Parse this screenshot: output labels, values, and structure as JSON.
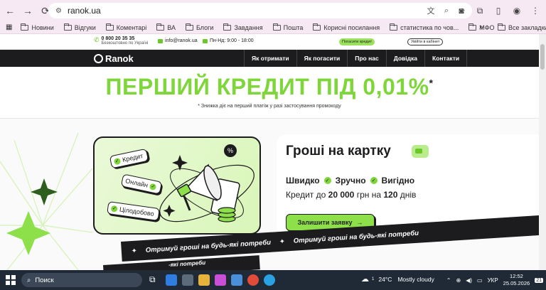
{
  "browser": {
    "url": "ranok.ua",
    "bookmarks": [
      "Новини",
      "Відгуки",
      "Коментарі",
      "ВА",
      "Блоги",
      "Завдання",
      "Пошта",
      "Корисні посилання",
      "статистика по чов...",
      "МФО"
    ],
    "all_bookmarks": "Все закладки"
  },
  "topbar": {
    "phone": "0 800 20 35 35",
    "phone_note": "Безкоштовно по Україні",
    "email": "info@ranok.ua",
    "hours": "Пн-Нд: 9:00 - 18:00",
    "pay_label": "Погасити кредит",
    "login_label": "Увійти в кабінет"
  },
  "nav": {
    "logo": "Ranok",
    "items": [
      "Як отримати",
      "Як погасити",
      "Про нас",
      "Довідка",
      "Контакти"
    ]
  },
  "hero": {
    "title": "ПЕРШИЙ КРЕДИТ ПІД 0,01%",
    "title_mark": "*",
    "subtitle": "* Знижка діє на перший платіж у разі застосування промокоду"
  },
  "illustration": {
    "pills": [
      "Кредит",
      "Онлайн",
      "Цілодобово"
    ],
    "percent": "%"
  },
  "offer": {
    "title": "Гроші на картку",
    "features": [
      "Швидко",
      "Зручно",
      "Вигідно"
    ],
    "loan_prefix": "Кредит до",
    "loan_amount": "20 000",
    "loan_mid": "грн на",
    "loan_days": "120",
    "loan_suffix": "днів",
    "apply_label": "Залишити заявку",
    "apply_arrow": "→"
  },
  "ticker": {
    "text": "Отримуй гроші на будь-які потреби",
    "partial": "-які потреби"
  },
  "taskbar": {
    "search_placeholder": "Поиск",
    "temperature": "24°C",
    "weather": "Mostly cloudy",
    "lang": "УКР",
    "time": "12:52",
    "date": "25.05.2026",
    "notifications": "21",
    "weather_badge": "1"
  }
}
